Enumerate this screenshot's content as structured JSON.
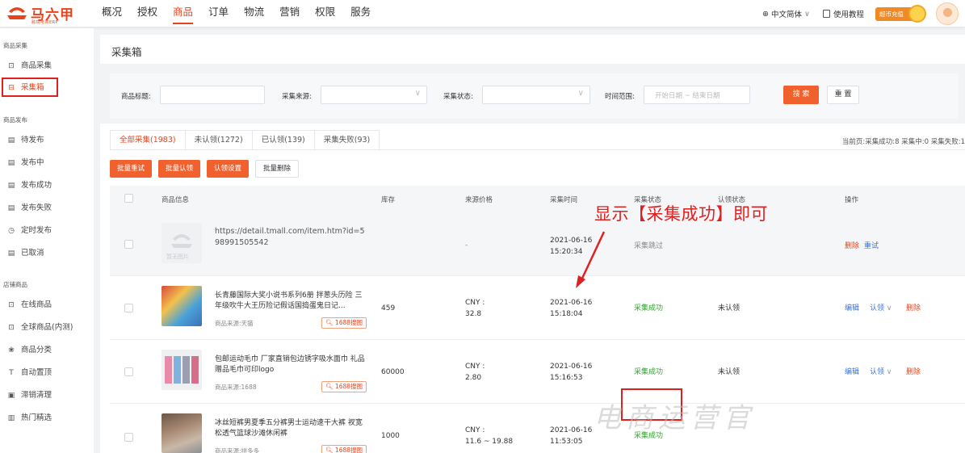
{
  "brand": {
    "name": "马六甲",
    "subtitle": "跨境电商ERP",
    "color": "#e8431c"
  },
  "nav": {
    "items": [
      {
        "label": "概况",
        "active": false
      },
      {
        "label": "授权",
        "active": false
      },
      {
        "label": "商品",
        "active": true
      },
      {
        "label": "订单",
        "active": false
      },
      {
        "label": "物流",
        "active": false
      },
      {
        "label": "营销",
        "active": false
      },
      {
        "label": "权限",
        "active": false
      },
      {
        "label": "服务",
        "active": false
      }
    ],
    "language": "中文简体",
    "tutorial": "使用教程",
    "recharge": "超币充值"
  },
  "sidebar": {
    "groups": [
      {
        "title": "商品采集",
        "items": [
          {
            "label": "商品采集",
            "icon": "download-icon",
            "active": false
          },
          {
            "label": "采集箱",
            "icon": "box-icon",
            "active": true
          }
        ]
      },
      {
        "title": "商品发布",
        "items": [
          {
            "label": "待发布",
            "icon": "doc-icon",
            "active": false
          },
          {
            "label": "发布中",
            "icon": "doc-icon",
            "active": false
          },
          {
            "label": "发布成功",
            "icon": "doc-icon",
            "active": false
          },
          {
            "label": "发布失败",
            "icon": "doc-icon",
            "active": false
          },
          {
            "label": "定时发布",
            "icon": "clock-icon",
            "active": false
          },
          {
            "label": "已取消",
            "icon": "doc-icon",
            "active": false
          }
        ]
      },
      {
        "title": "店铺商品",
        "items": [
          {
            "label": "在线商品",
            "icon": "store-icon",
            "active": false
          },
          {
            "label": "全球商品(内测)",
            "icon": "store-icon",
            "active": false
          },
          {
            "label": "商品分类",
            "icon": "category-icon",
            "active": false
          },
          {
            "label": "自动置顶",
            "icon": "pin-icon",
            "active": false
          },
          {
            "label": "滞销清理",
            "icon": "clean-icon",
            "active": false
          },
          {
            "label": "热门精选",
            "icon": "star-icon",
            "active": false
          }
        ]
      }
    ]
  },
  "page": {
    "title": "采集箱"
  },
  "filters": {
    "title_label": "商品标题:",
    "source_label": "采集来源:",
    "status_label": "采集状态:",
    "date_label": "时间范围:",
    "date_start_placeholder": "开始日期",
    "date_sep": "~",
    "date_end_placeholder": "结束日期",
    "search_button": "搜 索",
    "reset_button": "重 置"
  },
  "tabs": [
    {
      "label": "全部采集(1983)",
      "active": true
    },
    {
      "label": "未认领(1272)",
      "active": false
    },
    {
      "label": "已认领(139)",
      "active": false
    },
    {
      "label": "采集失败(93)",
      "active": false
    }
  ],
  "current_page_counts": "当前页:采集成功:8 采集中:0 采集失败:1",
  "batch_buttons": {
    "retry": "批量重试",
    "claim": "批量认领",
    "claim_settings": "认领设置",
    "delete": "批量删除"
  },
  "table": {
    "headers": [
      "商品信息",
      "库存",
      "来源价格",
      "采集时间",
      "采集状态",
      "认领状态",
      "操作"
    ],
    "rows": [
      {
        "title": "https://detail.tmall.com/item.htm?id=598991505542",
        "source": "",
        "tag": "",
        "stock": "",
        "price_currency": "",
        "price": "-",
        "date": "2021-06-16",
        "time": "15:20:34",
        "status": "采集跳过",
        "claim_status": "",
        "actions": [
          "删除",
          "重试"
        ],
        "thumb_label": "暂无图片"
      },
      {
        "title": "长青藤国际大奖小说书系列6册 拌葱头历险 三年级吹牛大王历险记假话国捣蛋鬼日记...",
        "source": "商品来源:天猫",
        "tag": "1688搜图",
        "stock": "459",
        "price_currency": "CNY :",
        "price": "32.8",
        "date": "2021-06-16",
        "time": "15:18:04",
        "status": "采集成功",
        "claim_status": "未认领",
        "actions": [
          "编辑",
          "认领",
          "删除"
        ]
      },
      {
        "title": "包邮运动毛巾 厂家直销包边锈字吸水面巾 礼品赠品毛巾可印logo",
        "source": "商品来源:1688",
        "tag": "1688搜图",
        "stock": "60000",
        "price_currency": "CNY :",
        "price": "2.80",
        "date": "2021-06-16",
        "time": "15:16:53",
        "status": "采集成功",
        "claim_status": "未认领",
        "actions": [
          "编辑",
          "认领",
          "删除"
        ]
      },
      {
        "title": "冰丝短裤男夏季五分裤男士运动速干大裤 衩宽松透气篮球沙滩休闲裤",
        "source": "商品来源:拼多多",
        "tag": "1688搜图",
        "stock": "1000",
        "price_currency": "CNY :",
        "price": "11.6 ~ 19.88",
        "date": "2021-06-16",
        "time": "11:53:05",
        "status": "采集成功",
        "claim_status": "",
        "actions": []
      }
    ]
  },
  "annotation": "显示【采集成功】即可",
  "watermark": "电商运营官",
  "colors": {
    "accent": "#f0612e",
    "success": "#31a62f",
    "link": "#3a73d6",
    "highlight": "#e02020"
  }
}
